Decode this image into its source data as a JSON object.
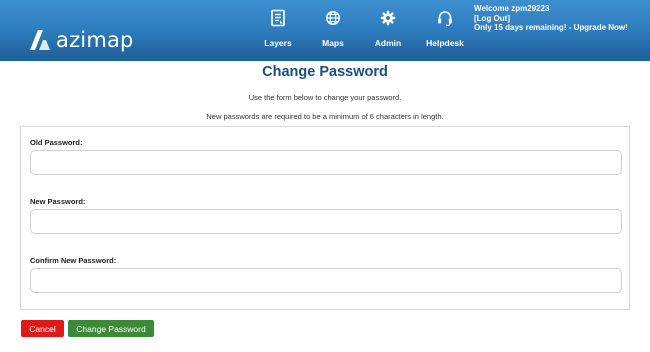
{
  "header": {
    "logo_text": "azimap",
    "nav": [
      {
        "label": "Layers",
        "icon": "layers-icon"
      },
      {
        "label": "Maps",
        "icon": "globe-icon"
      },
      {
        "label": "Admin",
        "icon": "gear-icon"
      },
      {
        "label": "Helpdesk",
        "icon": "headset-icon"
      }
    ],
    "user": {
      "welcome": "Welcome zpm29223",
      "logout": "[Log Out]",
      "trial": "Only 15 days remaining! - Upgrade Now!"
    }
  },
  "page": {
    "title": "Change Password",
    "intro": "Use the form below to change your password.",
    "requirement": "New passwords are required to be a minimum of 6 characters in length."
  },
  "form": {
    "old_password": {
      "label": "Old Password:",
      "value": ""
    },
    "new_password": {
      "label": "New Password:",
      "value": ""
    },
    "confirm_password": {
      "label": "Confirm New Password:",
      "value": ""
    }
  },
  "actions": {
    "cancel": "Cancel",
    "change": "Change Password"
  },
  "colors": {
    "header_top": "#3d8fcf",
    "header_bottom": "#1f5e97",
    "title": "#1b4f7a",
    "cancel": "#dd1a1a",
    "change": "#3a8a37"
  }
}
